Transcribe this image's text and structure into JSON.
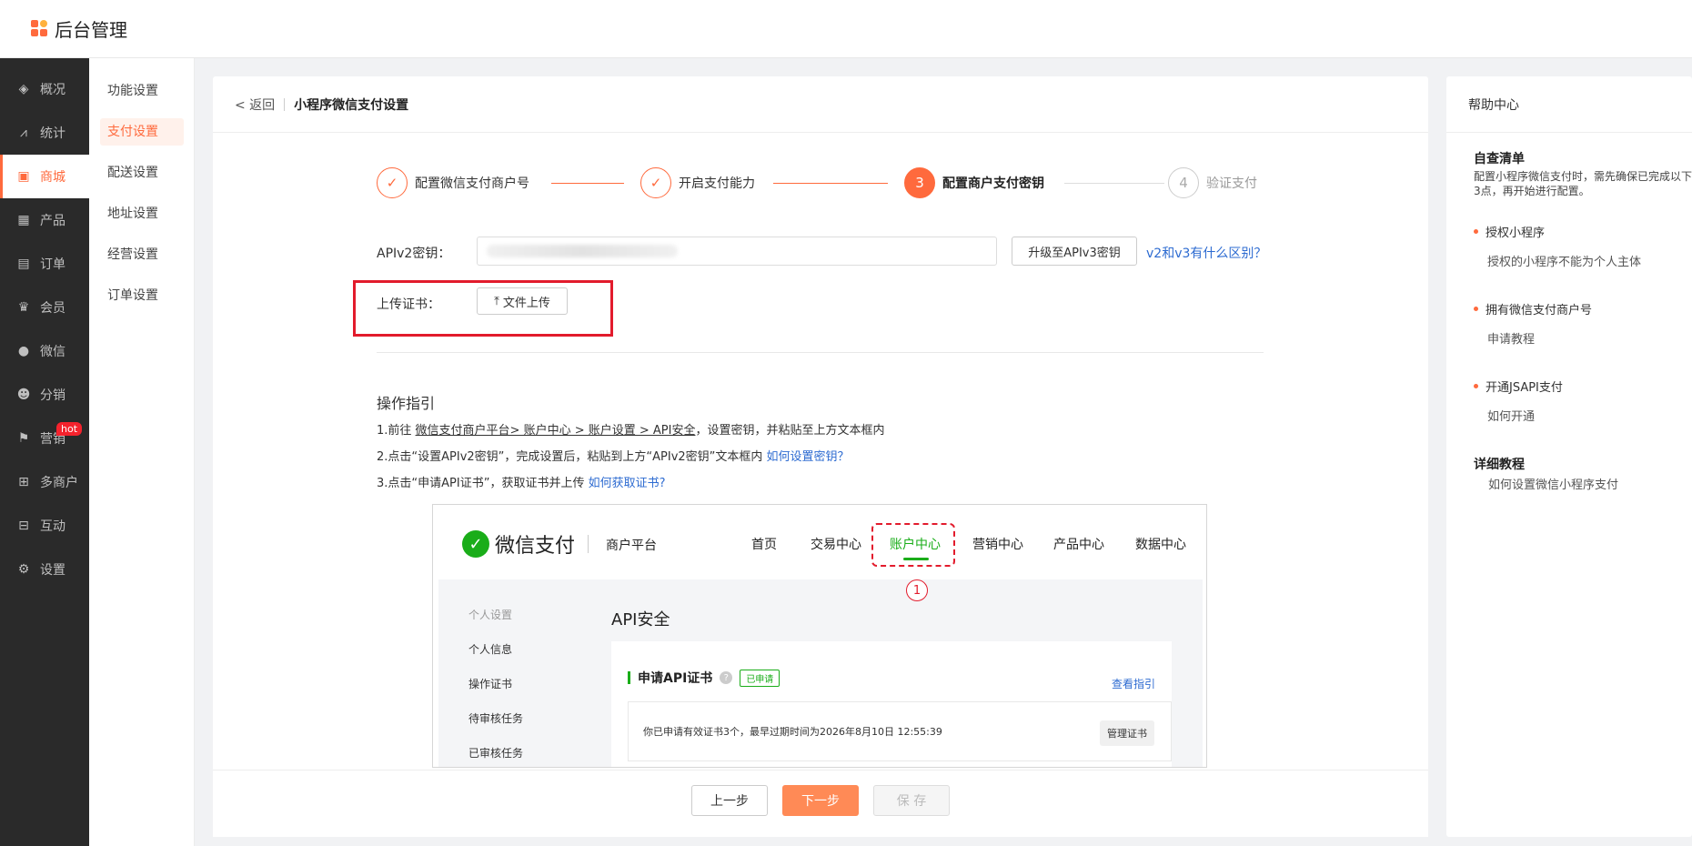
{
  "app": {
    "title": "后台管理"
  },
  "sidebar": {
    "items": [
      {
        "label": "概况",
        "icon": "layers-icon"
      },
      {
        "label": "统计",
        "icon": "chart-icon"
      },
      {
        "label": "商城",
        "icon": "shop-icon"
      },
      {
        "label": "产品",
        "icon": "grid-icon"
      },
      {
        "label": "订单",
        "icon": "order-icon"
      },
      {
        "label": "会员",
        "icon": "crown-icon"
      },
      {
        "label": "微信",
        "icon": "wechat-icon"
      },
      {
        "label": "分销",
        "icon": "users-icon"
      },
      {
        "label": "营销",
        "icon": "flag-icon",
        "badge": "hot"
      },
      {
        "label": "多商户",
        "icon": "merchant-icon"
      },
      {
        "label": "互动",
        "icon": "interact-icon"
      },
      {
        "label": "设置",
        "icon": "gear-icon"
      }
    ],
    "active_index": 2
  },
  "subnav": {
    "items": [
      "功能设置",
      "支付设置",
      "配送设置",
      "地址设置",
      "经营设置",
      "订单设置"
    ],
    "active_index": 1
  },
  "header": {
    "back": "< 返回",
    "title": "小程序微信支付设置"
  },
  "steps": [
    {
      "num": "✓",
      "label": "配置微信支付商户号",
      "state": "done"
    },
    {
      "num": "✓",
      "label": "开启支付能力",
      "state": "done"
    },
    {
      "num": "3",
      "label": "配置商户支付密钥",
      "state": "current"
    },
    {
      "num": "4",
      "label": "验证支付",
      "state": "pending"
    }
  ],
  "form": {
    "api_key_label": "APIv2密钥：",
    "upgrade_button": "升级至APIv3密钥",
    "diff_link": "v2和v3有什么区别？",
    "upload_label": "上传证书：",
    "upload_button": "文件上传"
  },
  "guide": {
    "title": "操作指引",
    "line1_prefix": "1.前往 ",
    "line1_path": "微信支付商户平台> 账户中心 > 账户设置 > API安全",
    "line1_suffix": "，设置密钥，并粘贴至上方文本框内",
    "line2_text": "2.点击“设置APIv2密钥”，完成设置后，粘贴到上方“APIv2密钥”文本框内 ",
    "line2_link": "如何设置密钥？",
    "line3_text": "3.点击“申请API证书”，获取证书并上传 ",
    "line3_link": "如何获取证书?"
  },
  "screenshot": {
    "brand": "微信支付",
    "platform": "商户平台",
    "nav": [
      "首页",
      "交易中心",
      "账户中心",
      "营销中心",
      "产品中心",
      "数据中心"
    ],
    "nav_active_index": 2,
    "marker": "1",
    "side": [
      "个人设置",
      "个人信息",
      "操作证书",
      "待审核任务",
      "已审核任务"
    ],
    "api_title": "API安全",
    "card_title": "申请API证书",
    "card_badge": "已申请",
    "card_guide": "查看指引",
    "info_text": "你已申请有效证书3个，最早过期时间为2026年8月10日 12:55:39",
    "manage_button": "管理证书"
  },
  "footer": {
    "prev": "上一步",
    "next": "下一步",
    "save": "保 存"
  },
  "help": {
    "title": "帮助中心",
    "checklist_title": "自查清单",
    "checklist_desc_1": "配置小程序微信支付时，需先确保已完成以下",
    "checklist_desc_2": "3点，再开始进行配置。",
    "items": [
      {
        "label": "授权小程序",
        "sub": "授权的小程序不能为个人主体"
      },
      {
        "label": "拥有微信支付商户号",
        "sub": "申请教程"
      },
      {
        "label": "开通JSAPI支付",
        "sub": "如何开通"
      }
    ],
    "tutorial_title": "详细教程",
    "tutorial_link": "如何设置微信小程序支付"
  },
  "colors": {
    "accent": "#ff6a3d",
    "sidebar_bg": "#2a2a2a",
    "wechat_green": "#1aad19",
    "highlight_red": "#e21b2c"
  }
}
